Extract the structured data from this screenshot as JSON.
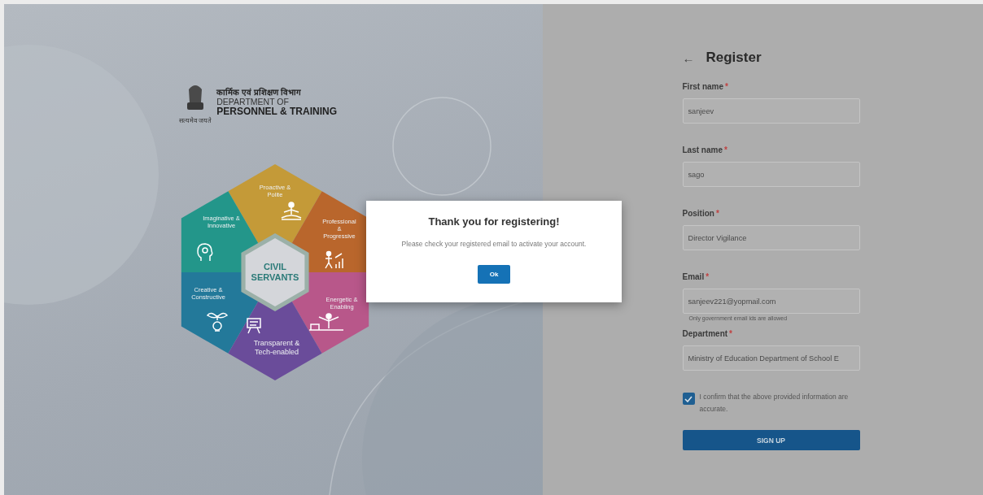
{
  "logo": {
    "hindi": "कार्मिक एवं प्रशिक्षण विभाग",
    "line1": "DEPARTMENT OF",
    "line2": "PERSONNEL & TRAINING",
    "motto": "सत्यमेव जयते"
  },
  "diagram": {
    "center": [
      "CIVIL",
      "SERVANTS"
    ],
    "segments": [
      {
        "kind": "meditation",
        "lines": [
          "Proactive &",
          "Polite"
        ],
        "color": "#c49a38"
      },
      {
        "kind": "head",
        "lines": [
          "Imaginative &",
          "Innovative"
        ],
        "color": "#23968a"
      },
      {
        "kind": "growth",
        "lines": [
          "Professional",
          "&",
          "Progressive"
        ],
        "color": "#b9662c"
      },
      {
        "kind": "bulb",
        "lines": [
          "Creative &",
          "Constructive"
        ],
        "color": "#23799a"
      },
      {
        "kind": "balance",
        "lines": [
          "Energetic &",
          "Enabling"
        ],
        "color": "#b8578a"
      },
      {
        "kind": "board",
        "lines": [
          "Transparent &",
          "Tech-enabled"
        ],
        "color": "#6a4c9a"
      }
    ]
  },
  "form": {
    "back": "←",
    "title": "Register",
    "fields": [
      {
        "label": "First name",
        "required": "*",
        "value": "sanjeev"
      },
      {
        "label": "Last name",
        "required": "*",
        "value": "sago"
      },
      {
        "label": "Position",
        "required": "*",
        "value": "Director Vigilance"
      },
      {
        "label": "Email",
        "required": "*",
        "value": "sanjeev221@yopmail.com",
        "hint": "Only government email ids are allowed"
      },
      {
        "label": "Department",
        "required": "*",
        "value": "Ministry of Education Department of School E"
      }
    ],
    "confirm": {
      "text": "I confirm that the above provided information are accurate.",
      "checked": true
    },
    "submit": "SIGN UP"
  },
  "dialog": {
    "title": "Thank you for registering!",
    "message": "Please check your registered email to activate your account.",
    "button": "Ok"
  }
}
